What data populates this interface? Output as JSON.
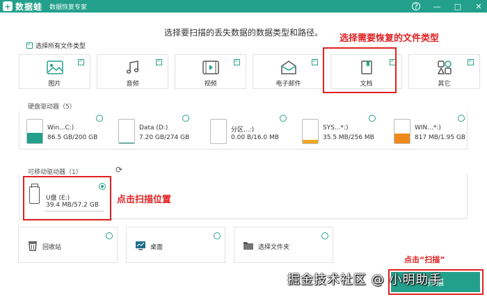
{
  "titlebar": {
    "logo_glyph": "+",
    "app_name": "数据蛙",
    "subtitle": "数据恢复专家",
    "help_label": "?",
    "minimize_label": "—",
    "maximize_label": "□",
    "close_label": "✕",
    "color": "#23a08c"
  },
  "heading": "选择要扫描的丢失数据的数据类型和路径。",
  "select_all_label": "选择所有文件类型",
  "file_types": [
    {
      "label": "图片",
      "icon": "image-icon",
      "checked": true
    },
    {
      "label": "音频",
      "icon": "music-icon",
      "checked": true
    },
    {
      "label": "视频",
      "icon": "video-icon",
      "checked": true
    },
    {
      "label": "电子邮件",
      "icon": "email-icon",
      "checked": true
    },
    {
      "label": "文档",
      "icon": "document-icon",
      "checked": true
    },
    {
      "label": "其它",
      "icon": "apps-icon",
      "checked": true
    }
  ],
  "annotations": {
    "file_type": "选择需要恢复的文件类型",
    "location": "点击扫描位置",
    "scan": "点击“扫描”",
    "color": "#e02020"
  },
  "hard_drives": {
    "title": "硬盘驱动器（5）",
    "drives": [
      {
        "name": "Win...C:)",
        "size": "86.5 GB/200 GB",
        "fill": 0.43,
        "color": "#23a08c"
      },
      {
        "name": "Data (D:)",
        "size": "7.20 GB/274 GB",
        "fill": 0.03,
        "color": "#23a08c"
      },
      {
        "name": "分区...:)",
        "size": "0.00  B/16.0 MB",
        "fill": 0.0,
        "color": "#f5a623"
      },
      {
        "name": "SYS...*:)",
        "size": "35.5 MB/256 MB",
        "fill": 0.14,
        "color": "#f5a623"
      },
      {
        "name": "WIN...*:)",
        "size": "817 MB/1.95 GB",
        "fill": 0.42,
        "color": "#ef8a1a"
      }
    ]
  },
  "removable": {
    "title": "可移动驱动器（1）",
    "refresh_icon": "refresh-icon",
    "drive": {
      "name": "U盘 (E:)",
      "size": "39.4 MB/57.2 GB",
      "selected": true
    }
  },
  "locations": [
    {
      "label": "回收站",
      "icon": "recycle-bin-icon"
    },
    {
      "label": "桌面",
      "icon": "desktop-icon"
    },
    {
      "label": "选择文件夹",
      "icon": "folder-icon"
    }
  ],
  "scan_button": "扫描",
  "watermark": "掘金技术社区 @ 小明助手"
}
